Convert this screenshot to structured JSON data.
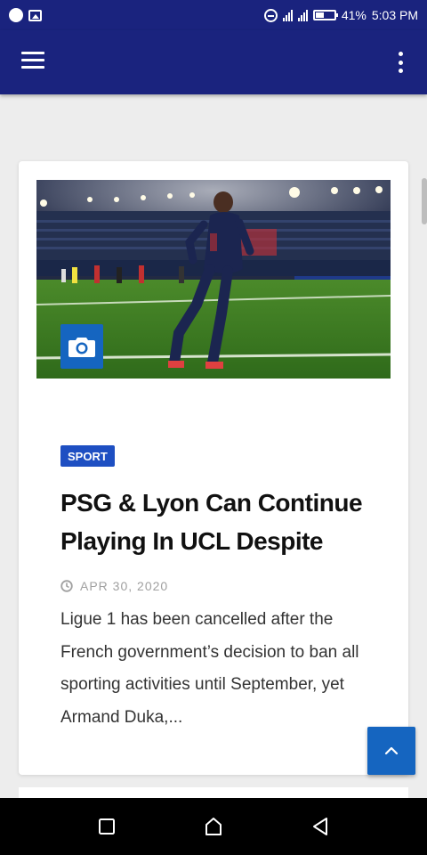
{
  "status_bar": {
    "battery": "41%",
    "time": "5:03 PM"
  },
  "app_bar": {
    "icons": [
      "menu-icon",
      "more-vert-icon"
    ]
  },
  "article": {
    "category": "SPORT",
    "title": "PSG & Lyon Can Continue Playing In UCL Despite",
    "date": "APR 30, 2020",
    "excerpt": "Ligue 1 has been cancelled after the French government’s decision to ban all sporting activities until September, yet Armand Duka,...",
    "image_badge_icon": "camera-icon"
  },
  "colors": {
    "primary": "#1a237e",
    "accent": "#1e4fc2",
    "background": "#ededed"
  }
}
